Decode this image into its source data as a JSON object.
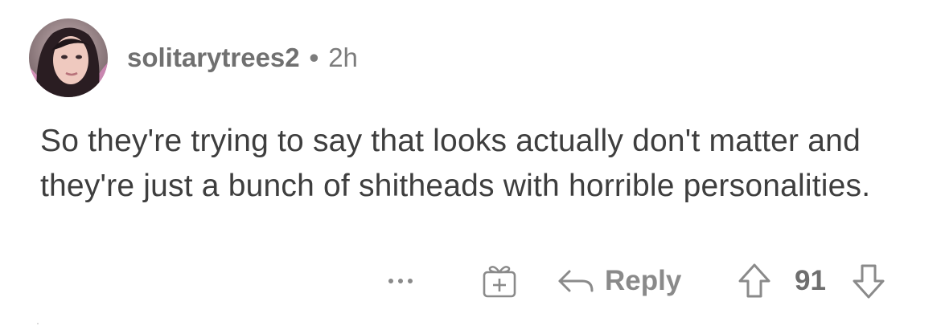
{
  "comment": {
    "username": "solitarytrees2",
    "separator": "•",
    "timestamp": "2h",
    "text": "So they're trying to say that looks actually don't matter and they're just a bunch of shitheads with horrible personalities.",
    "avatar_icon": "user-avatar"
  },
  "actions": {
    "more_icon": "more-options-icon",
    "gift_icon": "gift-award-icon",
    "reply_icon": "reply-arrow-icon",
    "reply_label": "Reply",
    "upvote_icon": "upvote-arrow-icon",
    "score": "91",
    "downvote_icon": "downvote-arrow-icon"
  },
  "colors": {
    "meta_text": "#7c7c7c",
    "body_text": "#3e3e3e",
    "icon": "#8a8a8a"
  }
}
